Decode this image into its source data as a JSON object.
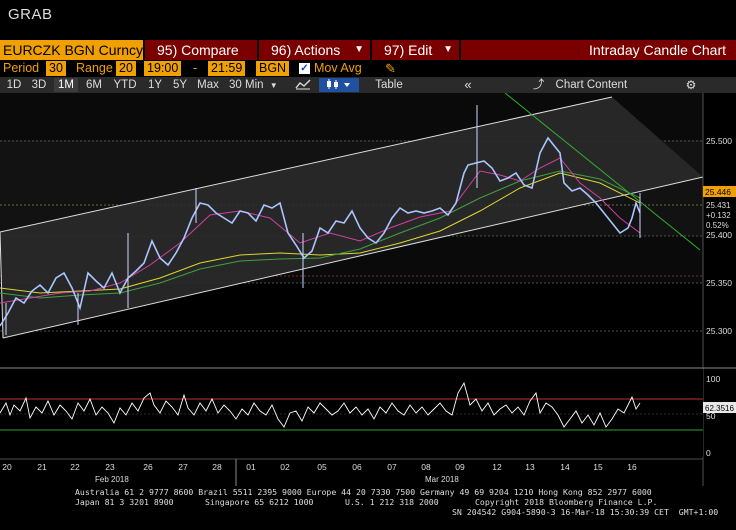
{
  "window": {
    "title": "GRAB"
  },
  "toolbar": {
    "ticker": "EURCZK BGN Curncy",
    "compare": "95) Compare",
    "actions": "96) Actions",
    "edit": "97) Edit",
    "chart_title": "Intraday Candle Chart"
  },
  "settings": {
    "period_label": "Period",
    "period_value": "30",
    "range_label": "Range",
    "range_value": "20",
    "time_start": "19:00",
    "time_sep": "-",
    "time_end": "21:59",
    "source": "BGN",
    "mov_avg_label": "Mov Avg"
  },
  "range_buttons": [
    "1D",
    "3D",
    "1M",
    "6M",
    "YTD",
    "1Y",
    "5Y",
    "Max"
  ],
  "selected_range": "1M",
  "interval": "30 Min",
  "nav": {
    "table_label": "Table",
    "chart_content_label": "Chart Content"
  },
  "price_axis": {
    "ticks": [
      "25.500",
      "25.400",
      "25.350",
      "25.300"
    ],
    "last_price": "25.446",
    "change": "+0.132",
    "change_pct": "0.52%",
    "cur": "25.431"
  },
  "rsi_axis": {
    "ticks": [
      "100",
      "50",
      "0"
    ],
    "value": "62.3516"
  },
  "x_axis": {
    "days": [
      "20",
      "21",
      "22",
      "23",
      "26",
      "27",
      "28",
      "01",
      "02",
      "05",
      "06",
      "07",
      "08",
      "09",
      "12",
      "13",
      "14",
      "15",
      "16"
    ],
    "months": [
      "Feb 2018",
      "Mar 2018"
    ]
  },
  "footer": {
    "line1": "Australia 61 2 9777 8600 Brazil 5511 2395 9000 Europe 44 20 7330 7500 Germany 49 69 9204 1210 Hong Kong 852 2977 6000",
    "line2a": "Japan 81 3 3201 8900",
    "line2b": "Singapore 65 6212 1000",
    "line2c": "U.S. 1 212 318 2000",
    "line2d": "Copyright 2018 Bloomberg Finance L.P.",
    "line3": "SN 204542 G904-5890-3 16-Mar-18 15:30:39 CET  GMT+1:00"
  },
  "colors": {
    "amber": "#f0a000",
    "dark_red": "#7a0000",
    "rsi_line": "#ffffff",
    "ma_yellow": "#d8d830",
    "ma_magenta": "#d040a0",
    "ma_green": "#40a040"
  }
}
